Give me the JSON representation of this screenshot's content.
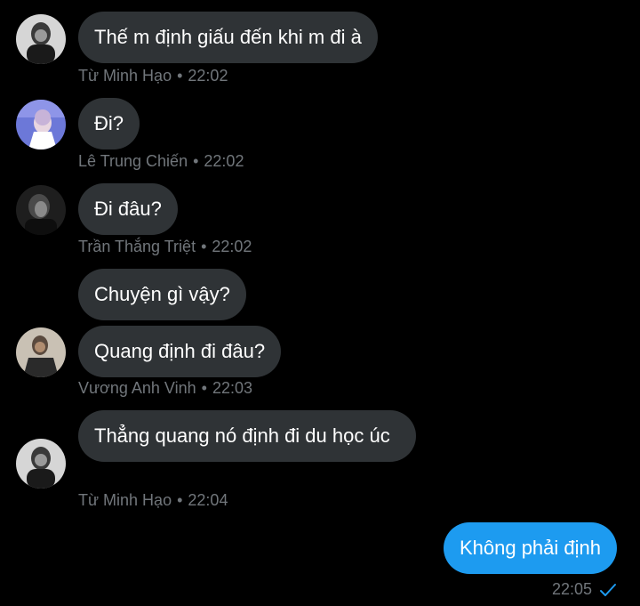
{
  "messages": [
    {
      "text": "Thế m định giấu đến khi m đi à",
      "sender": "Từ Minh Hạo",
      "time": "22:02"
    },
    {
      "text": "Đi?",
      "sender": "Lê Trung Chiến",
      "time": "22:02"
    },
    {
      "text": "Đi đâu?",
      "sender": "Trần Thắng Triệt",
      "time": "22:02"
    },
    {
      "text": "Chuyện gì vậy?"
    },
    {
      "text": "Quang định đi đâu?",
      "sender": "Vương Anh Vinh",
      "time": "22:03"
    },
    {
      "text": "Thẳng quang nó định đi du học úc",
      "sender": "Từ Minh Hạo",
      "time": "22:04"
    }
  ],
  "outgoing": {
    "text": "Không phải định",
    "time": "22:05",
    "status_icon": "check-icon"
  },
  "meta_separator": "•",
  "colors": {
    "background": "#000000",
    "incoming_bubble": "#2f3336",
    "outgoing_bubble": "#1d9bf0",
    "meta_text": "#71767b",
    "check": "#1d9bf0"
  }
}
